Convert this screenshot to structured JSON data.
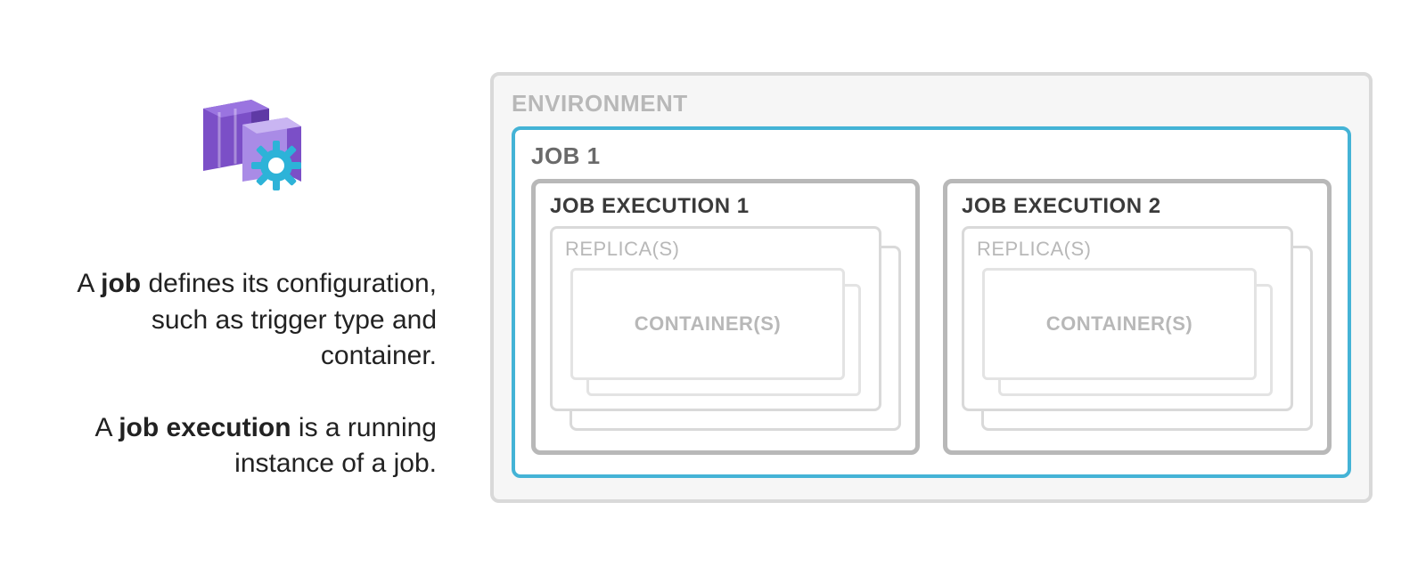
{
  "description": {
    "p1_pre": "A ",
    "p1_bold": "job",
    "p1_post": " defines its configuration, such as trigger type and container.",
    "p2_pre": "A ",
    "p2_bold": "job execution",
    "p2_post": " is a running instance of a job."
  },
  "diagram": {
    "environment_label": "ENVIRONMENT",
    "job_label": "JOB 1",
    "executions": [
      {
        "label": "JOB EXECUTION 1",
        "replica_label": "REPLICA(S)",
        "container_label": "CONTAINER(S)"
      },
      {
        "label": "JOB EXECUTION 2",
        "replica_label": "REPLICA(S)",
        "container_label": "CONTAINER(S)"
      }
    ]
  },
  "colors": {
    "accent": "#44b3d6",
    "purple_main": "#7b4fc7",
    "purple_dark": "#5f3aa5",
    "gear": "#2db3d8"
  }
}
